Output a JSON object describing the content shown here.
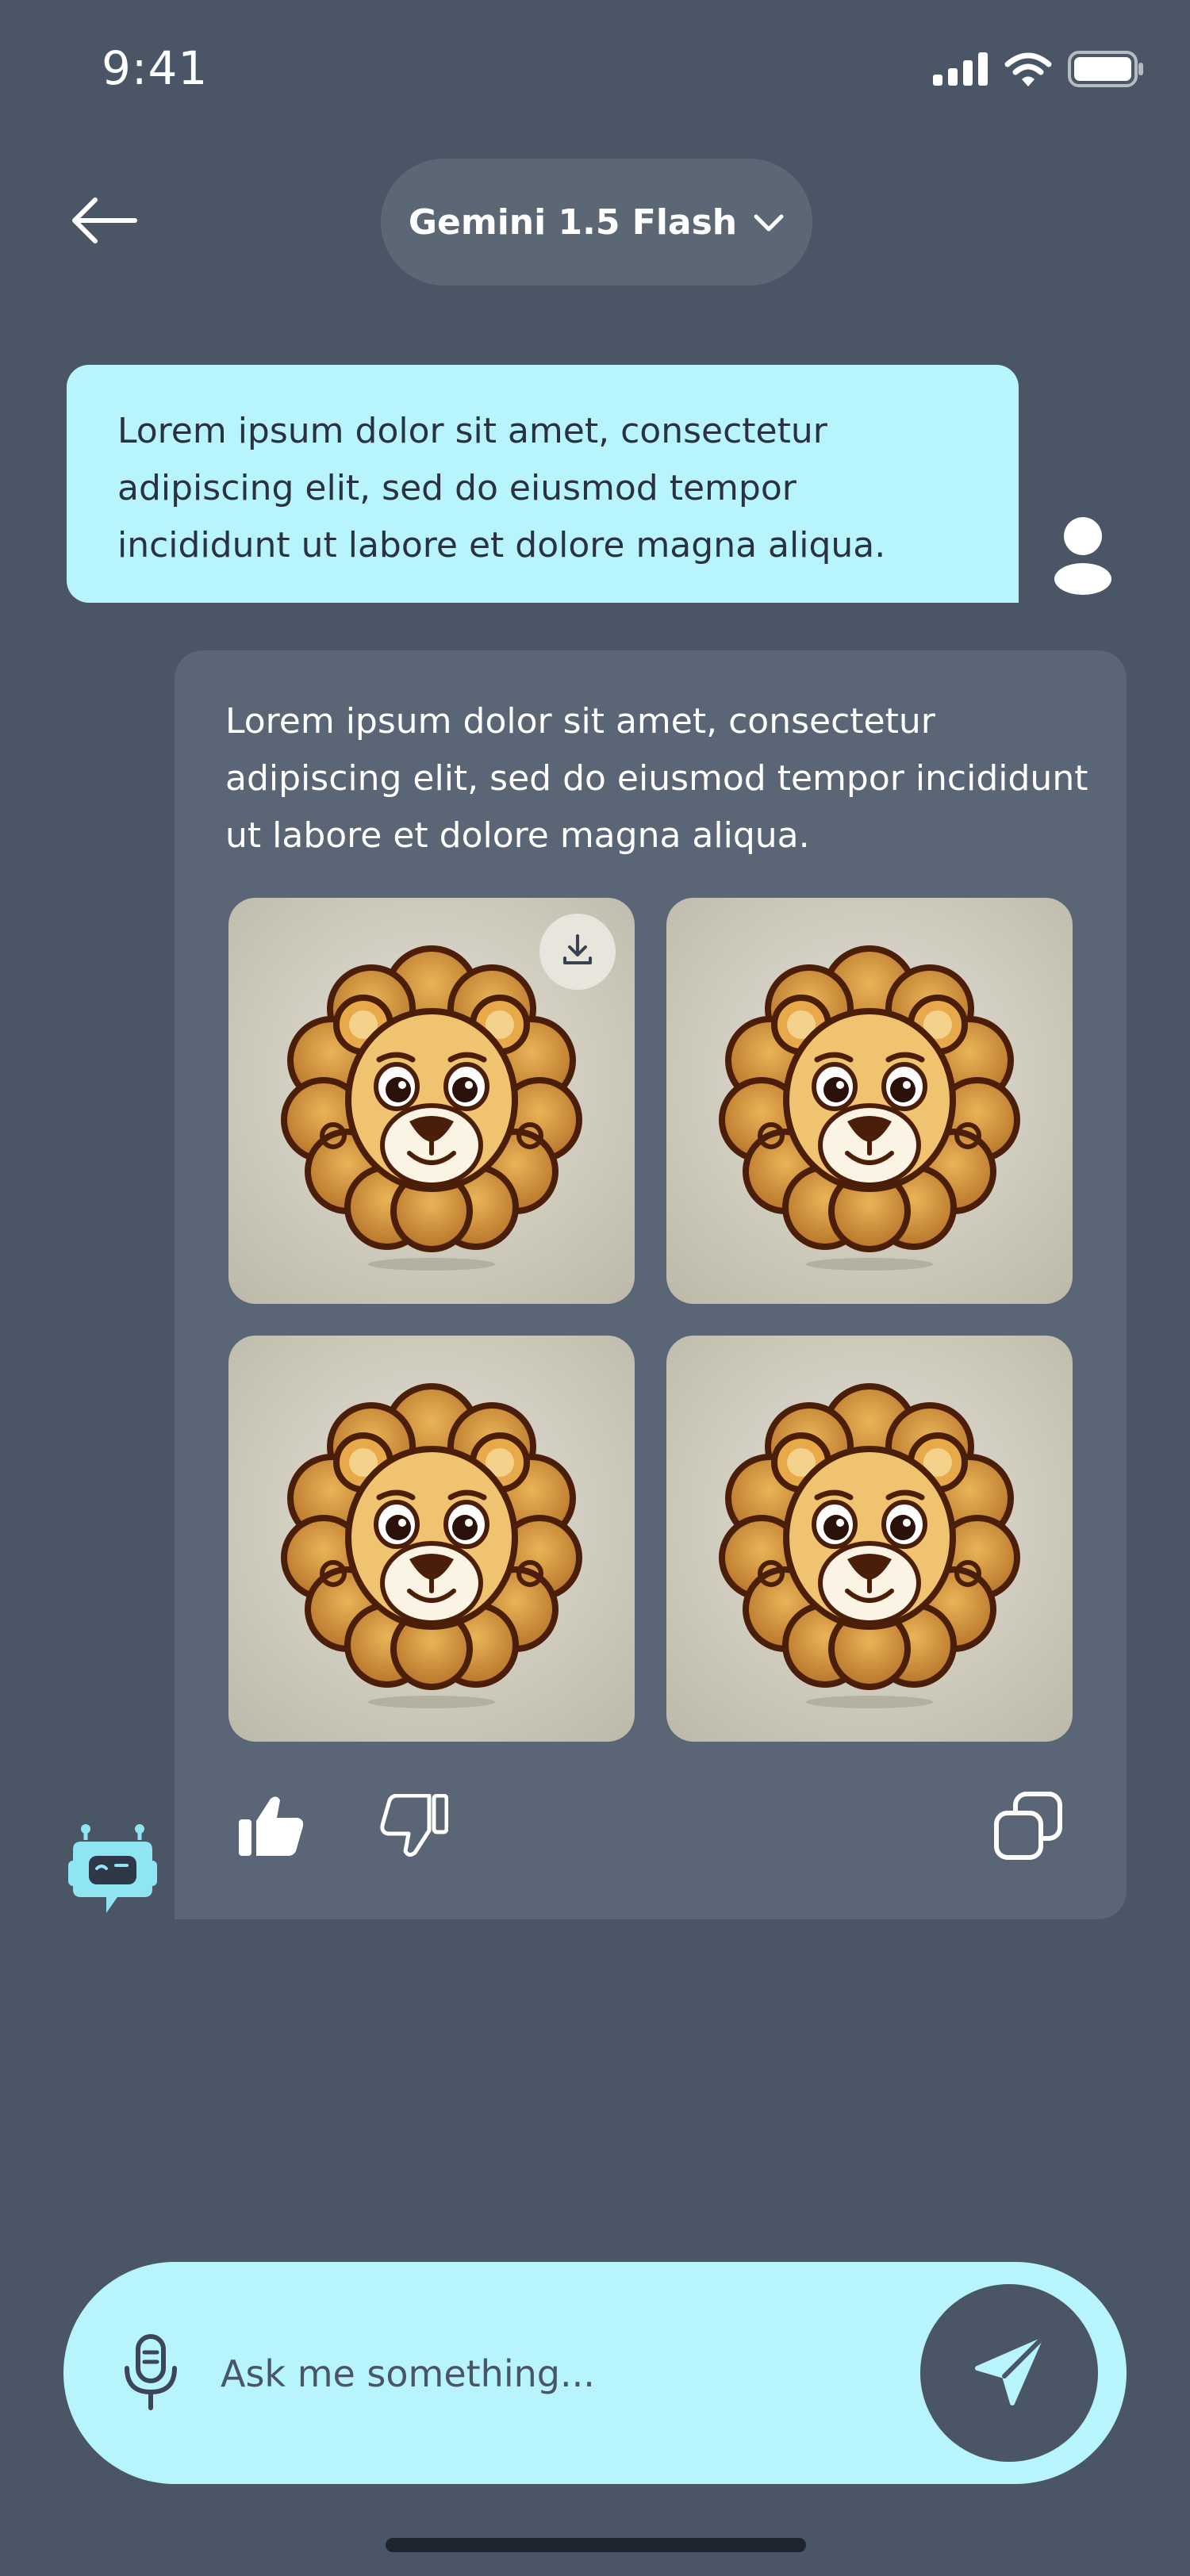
{
  "status_bar": {
    "time": "9:41",
    "icons": [
      "cellular-signal-icon",
      "wifi-icon",
      "battery-icon"
    ]
  },
  "header": {
    "back_icon": "arrow-left-icon",
    "model_selector": {
      "label": "Gemini 1.5 Flash",
      "icon": "chevron-down-icon"
    }
  },
  "conversation": {
    "user_message": {
      "text": "Lorem ipsum dolor sit amet, consectetur adipiscing elit, sed do eiusmod tempor incididunt ut labore et dolore magna aliqua.",
      "avatar_icon": "user-icon"
    },
    "bot_message": {
      "text": "Lorem ipsum dolor sit amet, consectetur adipiscing elit, sed do eiusmod tempor incididunt ut labore et dolore magna aliqua.",
      "images": [
        {
          "subject": "cartoon lion head",
          "download_icon": "download-icon"
        },
        {
          "subject": "cartoon lion head"
        },
        {
          "subject": "cartoon lion head"
        },
        {
          "subject": "cartoon lion head"
        }
      ],
      "actions": {
        "like_icon": "thumbs-up-icon",
        "dislike_icon": "thumbs-down-icon",
        "copy_icon": "copy-icon"
      },
      "avatar_icon": "robot-icon"
    }
  },
  "composer": {
    "mic_icon": "microphone-icon",
    "placeholder": "Ask me something...",
    "send_icon": "send-icon"
  },
  "colors": {
    "background": "#4a5566",
    "accent": "#b8f4fb",
    "bot_bubble": "#5a6575",
    "pill": "#5c6776"
  }
}
